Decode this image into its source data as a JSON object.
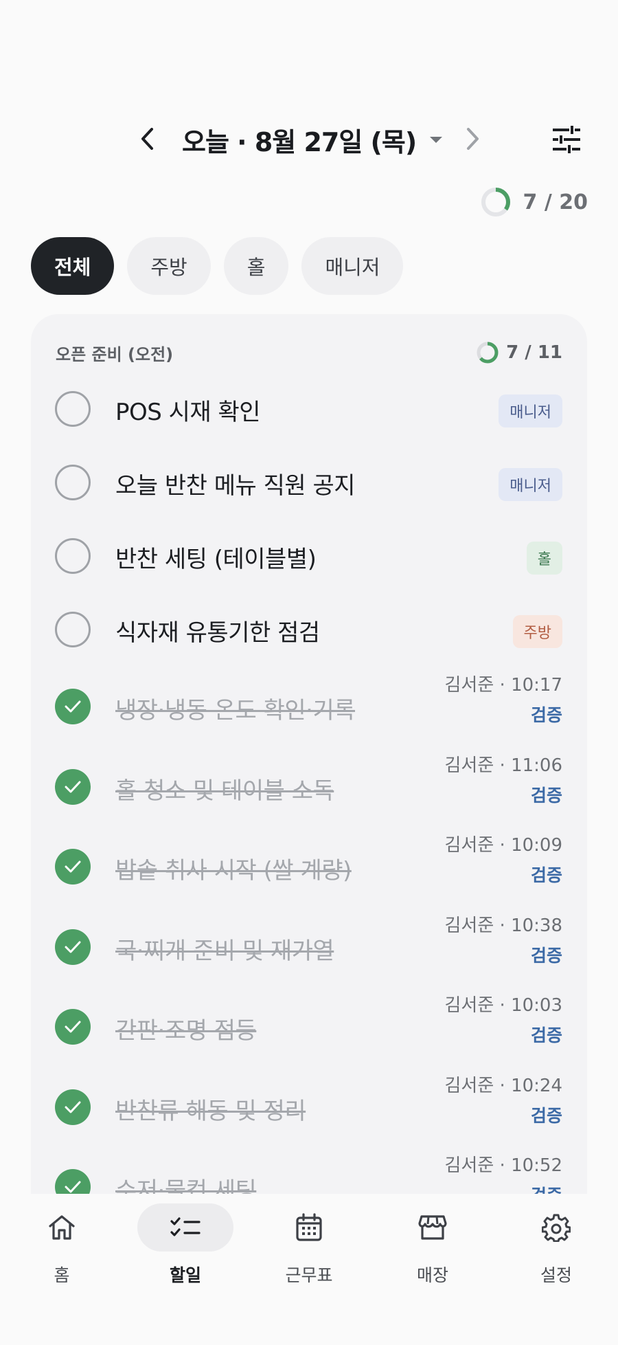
{
  "header": {
    "title": "오늘 · 8월 27일 (목)",
    "prev_icon": "chevron-left-icon",
    "next_icon": "chevron-right-icon",
    "filter_icon": "tune-sliders-icon"
  },
  "progress": {
    "text": "7 / 20",
    "done": 7,
    "total": 20,
    "color": "#4c9e64"
  },
  "chips": [
    {
      "label": "전체",
      "active": true
    },
    {
      "label": "주방",
      "active": false
    },
    {
      "label": "홀",
      "active": false
    },
    {
      "label": "매니저",
      "active": false
    }
  ],
  "section": {
    "title": "오픈 준비 (오전)",
    "progress_text": "7 / 11",
    "done": 7,
    "total": 11,
    "tasks": [
      {
        "name": "POS 시재 확인",
        "role": "매니저",
        "done": false
      },
      {
        "name": "오늘 반찬 메뉴 직원 공지",
        "role": "매니저",
        "done": false
      },
      {
        "name": "반찬 세팅 (테이블별)",
        "role": "홀",
        "done": false
      },
      {
        "name": "식자재 유통기한 점검",
        "role": "주방",
        "done": false
      },
      {
        "name": "냉장·냉동 온도 확인·기록",
        "done": true,
        "meta": "김서준 · 10:17",
        "verify": "검증"
      },
      {
        "name": "홀 청소 및 테이블 소독",
        "done": true,
        "meta": "김서준 · 11:06",
        "verify": "검증"
      },
      {
        "name": "밥솥 취사 시작 (쌀 계량)",
        "done": true,
        "meta": "김서준 · 10:09",
        "verify": "검증"
      },
      {
        "name": "국·찌개 준비 및 재가열",
        "done": true,
        "meta": "김서준 · 10:38",
        "verify": "검증"
      },
      {
        "name": "간판·조명 점등",
        "done": true,
        "meta": "김서준 · 10:03",
        "verify": "검증"
      },
      {
        "name": "반찬류 해동 및 정리",
        "done": true,
        "meta": "김서준 · 10:24",
        "verify": "검증"
      },
      {
        "name": "수저·물컵 세팅",
        "done": true,
        "meta": "김서준 · 10:52",
        "verify": "검증"
      }
    ]
  },
  "tabs": [
    {
      "label": "홈",
      "icon": "home-icon",
      "active": false
    },
    {
      "label": "할일",
      "icon": "checklist-icon",
      "active": true
    },
    {
      "label": "근무표",
      "icon": "calendar-icon",
      "active": false
    },
    {
      "label": "매장",
      "icon": "store-icon",
      "active": false
    },
    {
      "label": "설정",
      "icon": "gear-icon",
      "active": false
    }
  ]
}
